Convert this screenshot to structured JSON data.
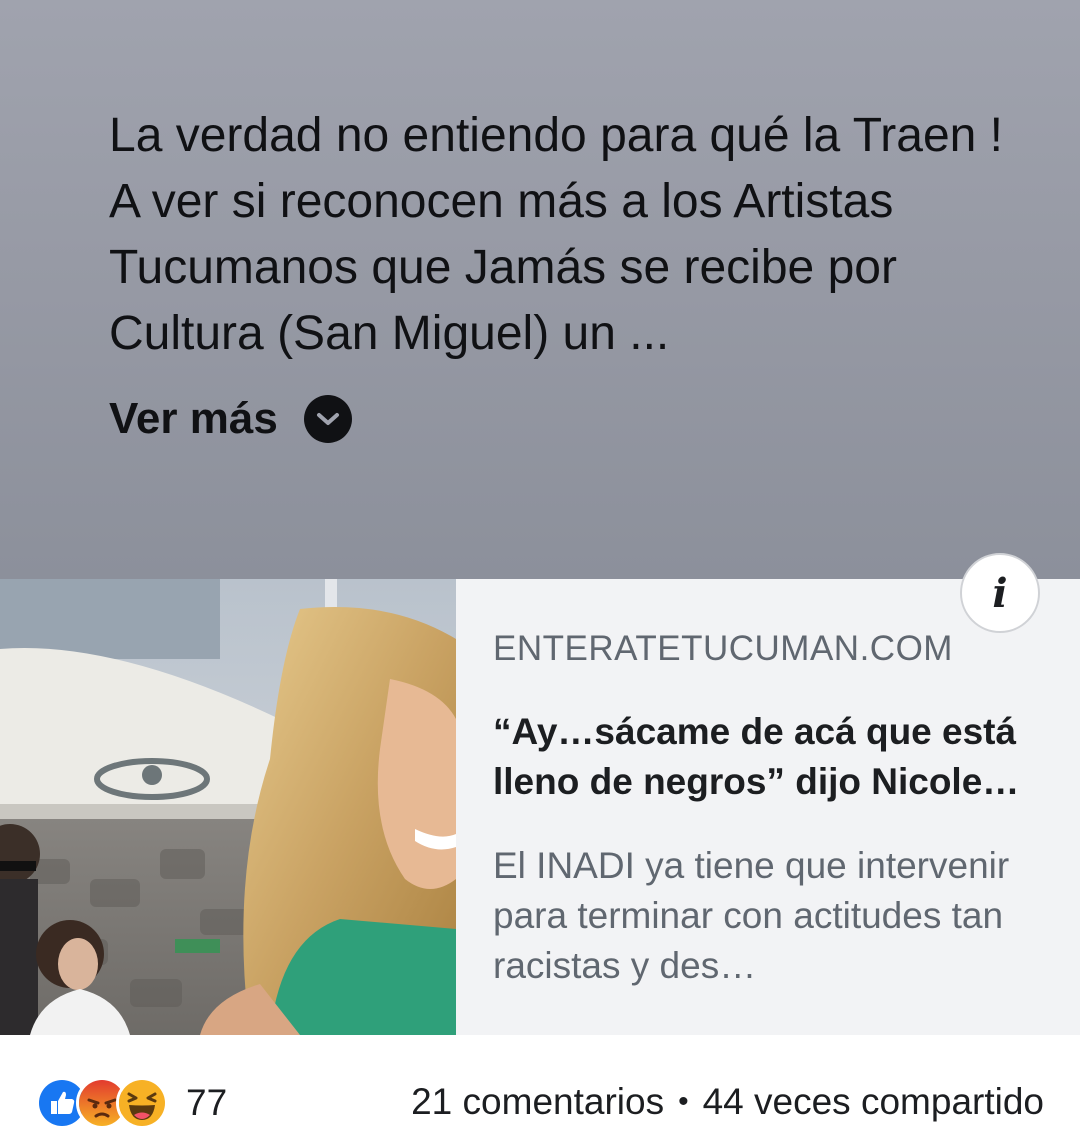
{
  "post": {
    "text": "La verdad no entiendo para qué la Traen ! A ver si reconocen más a los Artistas Tucumanos que Jamás se recibe por Cultura (San Miguel) un ...",
    "see_more_label": "Ver más",
    "background_color": "#979aa5"
  },
  "link_preview": {
    "domain": "ENTERATETUCUMAN.COM",
    "headline": "“Ay…sácame de acá que está lleno de negros” dijo Nicole…",
    "description": "El INADI ya tiene que intervenir para terminar con actitudes tan racistas y des…",
    "info_icon": "info-icon",
    "info_label": "i"
  },
  "footer": {
    "reaction_icons": [
      "like-reaction-icon",
      "angry-reaction-icon",
      "haha-reaction-icon"
    ],
    "reaction_count": "77",
    "comments": "21 comentarios",
    "separator": "•",
    "shares": "44 veces compartido"
  },
  "colors": {
    "like": "#1877f2",
    "angry": "#e9710f",
    "haha": "#f7b125"
  }
}
